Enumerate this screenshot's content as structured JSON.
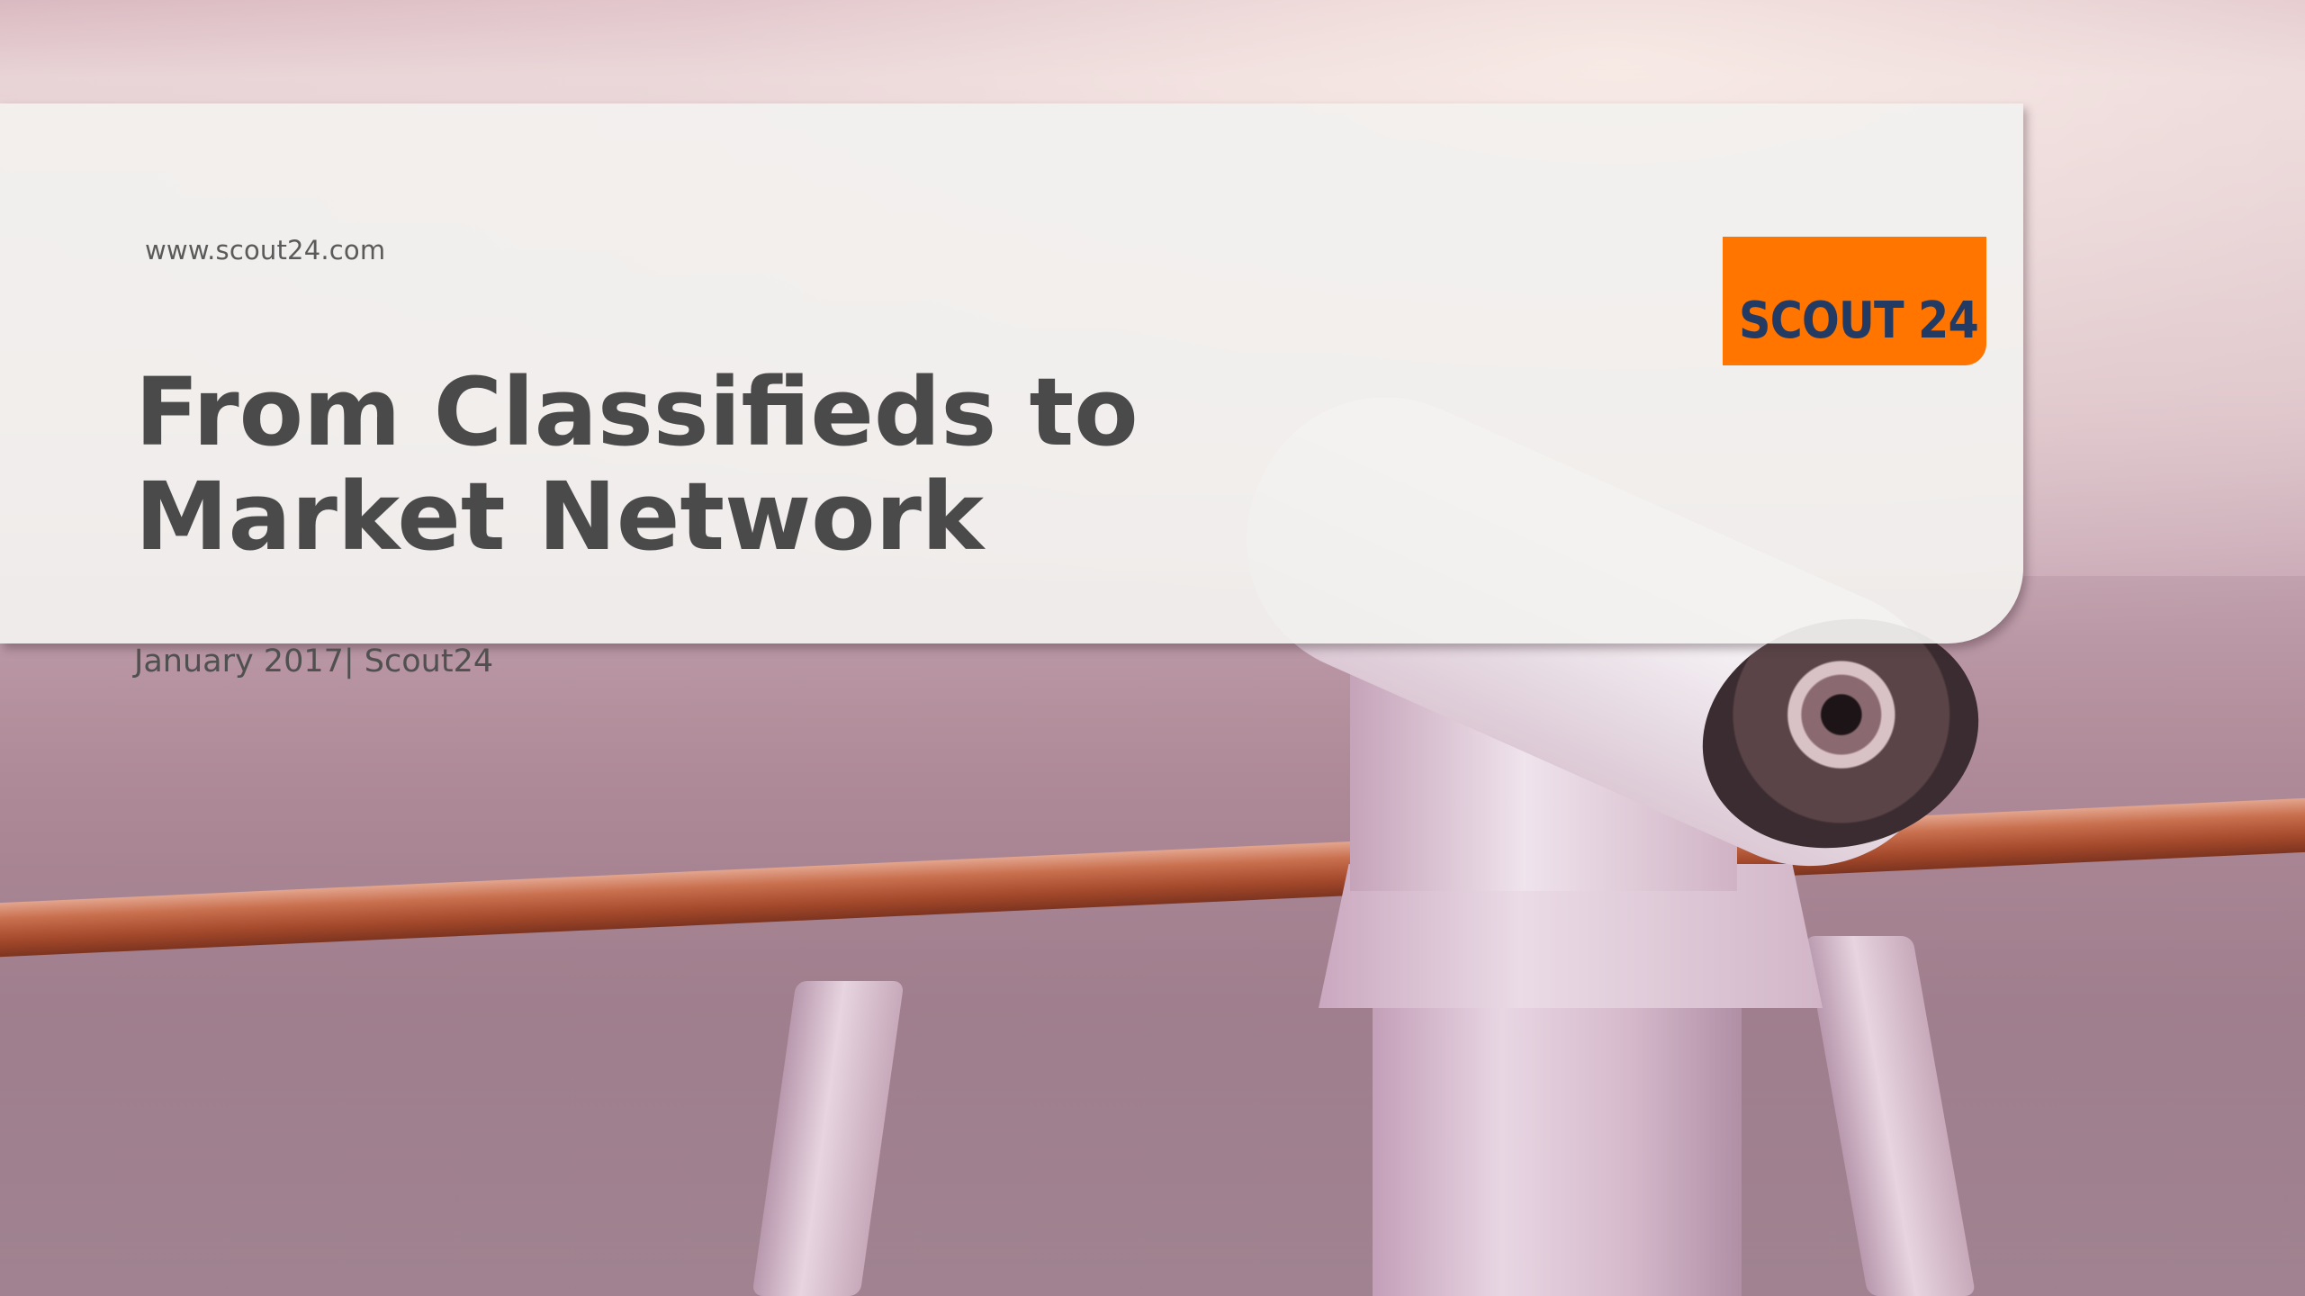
{
  "slide": {
    "url": "www.scout24.com",
    "title_lines": [
      "From Classifieds to",
      "Market Network"
    ],
    "subtitle": "January 2017| Scout24",
    "logo_text": "SCOUT 24"
  },
  "colors": {
    "logo_background": "#ff7500",
    "logo_text": "#233a63",
    "title_text": "#4a4a4a",
    "card_background": "#f2f1ef"
  },
  "background_image": {
    "subject": "coin-operated binocular telescope beside a railing overlooking the sea"
  }
}
